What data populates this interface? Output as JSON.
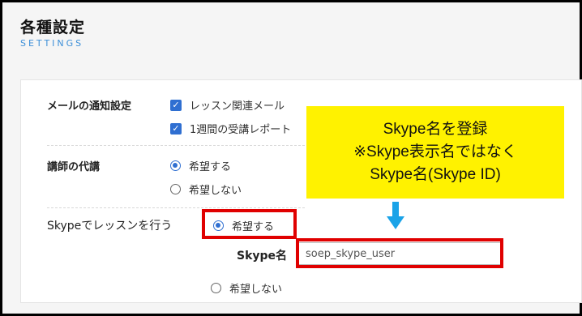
{
  "header": {
    "title": "各種設定",
    "subtitle": "SETTINGS"
  },
  "mail_settings": {
    "label": "メールの通知設定",
    "options": [
      {
        "label": "レッスン関連メール",
        "checked": true
      },
      {
        "label": "1週間の受講レポート",
        "checked": true
      }
    ]
  },
  "substitute": {
    "label": "講師の代講",
    "options": [
      {
        "label": "希望する",
        "selected": true
      },
      {
        "label": "希望しない",
        "selected": false
      }
    ]
  },
  "skype": {
    "label": "Skypeでレッスンを行う",
    "yes_label": "希望する",
    "no_label": "希望しない",
    "name_label": "Skype名",
    "name_value": "soep_skype_user",
    "selected": "yes"
  },
  "callout": {
    "line1": "Skype名を登録",
    "line2": "※Skype表示名ではなく",
    "line3": "Skype名(Skype ID)"
  },
  "colors": {
    "accent": "#2f6fd1",
    "subtitle": "#3c8fd8",
    "highlight": "#e00000",
    "callout_bg": "#fff200",
    "arrow": "#1aa3e8"
  },
  "icons": {
    "checkbox": "check-icon",
    "arrow": "arrow-down-icon"
  }
}
